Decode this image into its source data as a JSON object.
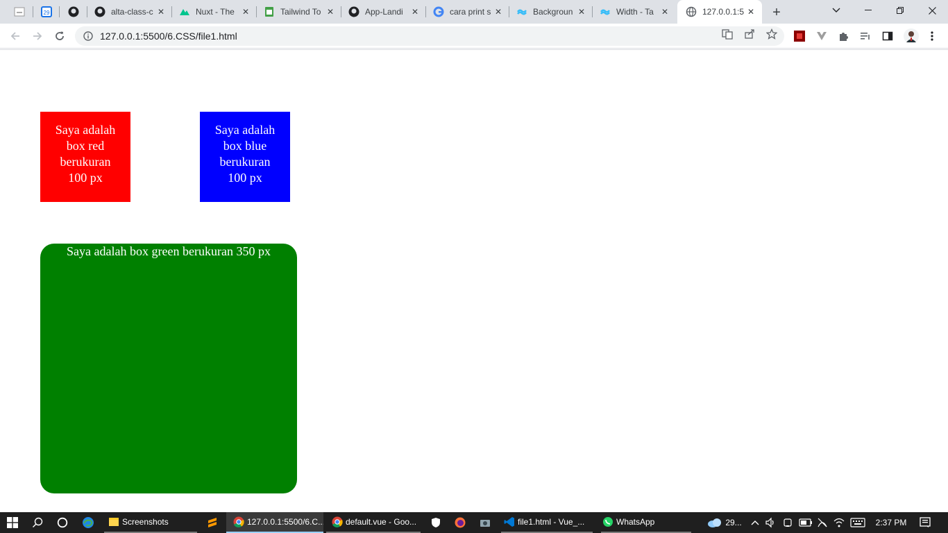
{
  "browser": {
    "tabs": [
      {
        "title": "",
        "favicon": "tab-favicon-white-icon",
        "pinned": true
      },
      {
        "title": "",
        "favicon": "calendar-icon",
        "pinned": true,
        "badge": "29"
      },
      {
        "title": "",
        "favicon": "github-icon",
        "pinned": true
      },
      {
        "title": "alta-class-c",
        "favicon": "github-icon"
      },
      {
        "title": "Nuxt - The",
        "favicon": "nuxt-icon"
      },
      {
        "title": "Tailwind To",
        "favicon": "sheets-icon"
      },
      {
        "title": "App-Landi",
        "favicon": "github-icon"
      },
      {
        "title": "cara print s",
        "favicon": "google-icon"
      },
      {
        "title": "Backgroun",
        "favicon": "tailwind-icon"
      },
      {
        "title": "Width - Ta",
        "favicon": "tailwind-icon"
      },
      {
        "title": "127.0.0.1:5",
        "favicon": "globe-icon",
        "active": true
      }
    ],
    "new_tab": "+",
    "url": "127.0.0.1:5500/6.CSS/file1.html"
  },
  "page": {
    "red_box_text": "Saya adalah box red berukuran 100 px",
    "blue_box_text": "Saya adalah box blue berukuran 100 px",
    "green_box_text": "Saya adalah box green berukuran 350 px",
    "colors": {
      "red": "#ff0000",
      "blue": "#0000ff",
      "green": "#008000"
    }
  },
  "taskbar": {
    "apps": [
      {
        "label": "Screenshots",
        "icon": "folder-icon"
      },
      {
        "label": "127.0.0.1:5500/6.C...",
        "icon": "chrome-icon",
        "active": true
      },
      {
        "label": "default.vue - Goo...",
        "icon": "chrome-icon"
      },
      {
        "label": "file1.html - Vue_...",
        "icon": "vscode-icon"
      },
      {
        "label": "WhatsApp",
        "icon": "whatsapp-icon"
      }
    ],
    "weather": "29...",
    "time": "2:37 PM"
  }
}
